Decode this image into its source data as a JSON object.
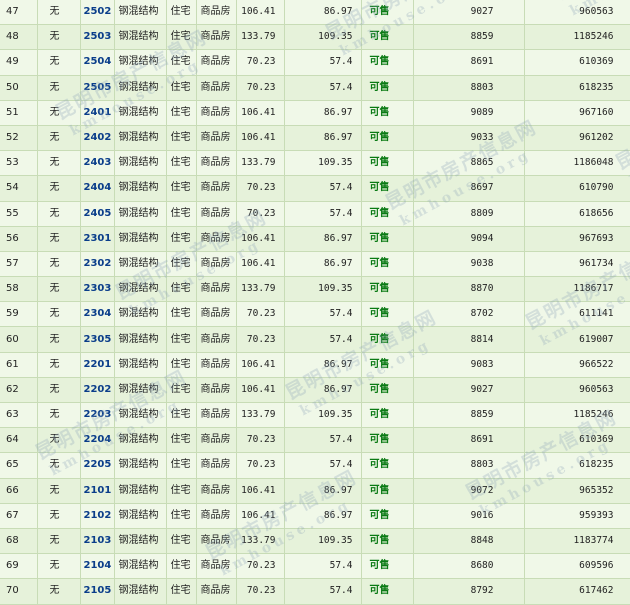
{
  "watermark": {
    "cn": "昆明市房产信息网",
    "en": "kmhouse.org"
  },
  "rows": [
    [
      "47",
      "无",
      "2502",
      "钢混结构",
      "住宅",
      "商品房",
      "106.41",
      "86.97",
      "可售",
      "9027",
      "960563"
    ],
    [
      "48",
      "无",
      "2503",
      "钢混结构",
      "住宅",
      "商品房",
      "133.79",
      "109.35",
      "可售",
      "8859",
      "1185246"
    ],
    [
      "49",
      "无",
      "2504",
      "钢混结构",
      "住宅",
      "商品房",
      "70.23",
      "57.4",
      "可售",
      "8691",
      "610369"
    ],
    [
      "50",
      "无",
      "2505",
      "钢混结构",
      "住宅",
      "商品房",
      "70.23",
      "57.4",
      "可售",
      "8803",
      "618235"
    ],
    [
      "51",
      "无",
      "2401",
      "钢混结构",
      "住宅",
      "商品房",
      "106.41",
      "86.97",
      "可售",
      "9089",
      "967160"
    ],
    [
      "52",
      "无",
      "2402",
      "钢混结构",
      "住宅",
      "商品房",
      "106.41",
      "86.97",
      "可售",
      "9033",
      "961202"
    ],
    [
      "53",
      "无",
      "2403",
      "钢混结构",
      "住宅",
      "商品房",
      "133.79",
      "109.35",
      "可售",
      "8865",
      "1186048"
    ],
    [
      "54",
      "无",
      "2404",
      "钢混结构",
      "住宅",
      "商品房",
      "70.23",
      "57.4",
      "可售",
      "8697",
      "610790"
    ],
    [
      "55",
      "无",
      "2405",
      "钢混结构",
      "住宅",
      "商品房",
      "70.23",
      "57.4",
      "可售",
      "8809",
      "618656"
    ],
    [
      "56",
      "无",
      "2301",
      "钢混结构",
      "住宅",
      "商品房",
      "106.41",
      "86.97",
      "可售",
      "9094",
      "967693"
    ],
    [
      "57",
      "无",
      "2302",
      "钢混结构",
      "住宅",
      "商品房",
      "106.41",
      "86.97",
      "可售",
      "9038",
      "961734"
    ],
    [
      "58",
      "无",
      "2303",
      "钢混结构",
      "住宅",
      "商品房",
      "133.79",
      "109.35",
      "可售",
      "8870",
      "1186717"
    ],
    [
      "59",
      "无",
      "2304",
      "钢混结构",
      "住宅",
      "商品房",
      "70.23",
      "57.4",
      "可售",
      "8702",
      "611141"
    ],
    [
      "60",
      "无",
      "2305",
      "钢混结构",
      "住宅",
      "商品房",
      "70.23",
      "57.4",
      "可售",
      "8814",
      "619007"
    ],
    [
      "61",
      "无",
      "2201",
      "钢混结构",
      "住宅",
      "商品房",
      "106.41",
      "86.97",
      "可售",
      "9083",
      "966522"
    ],
    [
      "62",
      "无",
      "2202",
      "钢混结构",
      "住宅",
      "商品房",
      "106.41",
      "86.97",
      "可售",
      "9027",
      "960563"
    ],
    [
      "63",
      "无",
      "2203",
      "钢混结构",
      "住宅",
      "商品房",
      "133.79",
      "109.35",
      "可售",
      "8859",
      "1185246"
    ],
    [
      "64",
      "无",
      "2204",
      "钢混结构",
      "住宅",
      "商品房",
      "70.23",
      "57.4",
      "可售",
      "8691",
      "610369"
    ],
    [
      "65",
      "无",
      "2205",
      "钢混结构",
      "住宅",
      "商品房",
      "70.23",
      "57.4",
      "可售",
      "8803",
      "618235"
    ],
    [
      "66",
      "无",
      "2101",
      "钢混结构",
      "住宅",
      "商品房",
      "106.41",
      "86.97",
      "可售",
      "9072",
      "965352"
    ],
    [
      "67",
      "无",
      "2102",
      "钢混结构",
      "住宅",
      "商品房",
      "106.41",
      "86.97",
      "可售",
      "9016",
      "959393"
    ],
    [
      "68",
      "无",
      "2103",
      "钢混结构",
      "住宅",
      "商品房",
      "133.79",
      "109.35",
      "可售",
      "8848",
      "1183774"
    ],
    [
      "69",
      "无",
      "2104",
      "钢混结构",
      "住宅",
      "商品房",
      "70.23",
      "57.4",
      "可售",
      "8680",
      "609596"
    ],
    [
      "70",
      "无",
      "2105",
      "钢混结构",
      "住宅",
      "商品房",
      "70.23",
      "57.4",
      "可售",
      "8792",
      "617462"
    ]
  ]
}
